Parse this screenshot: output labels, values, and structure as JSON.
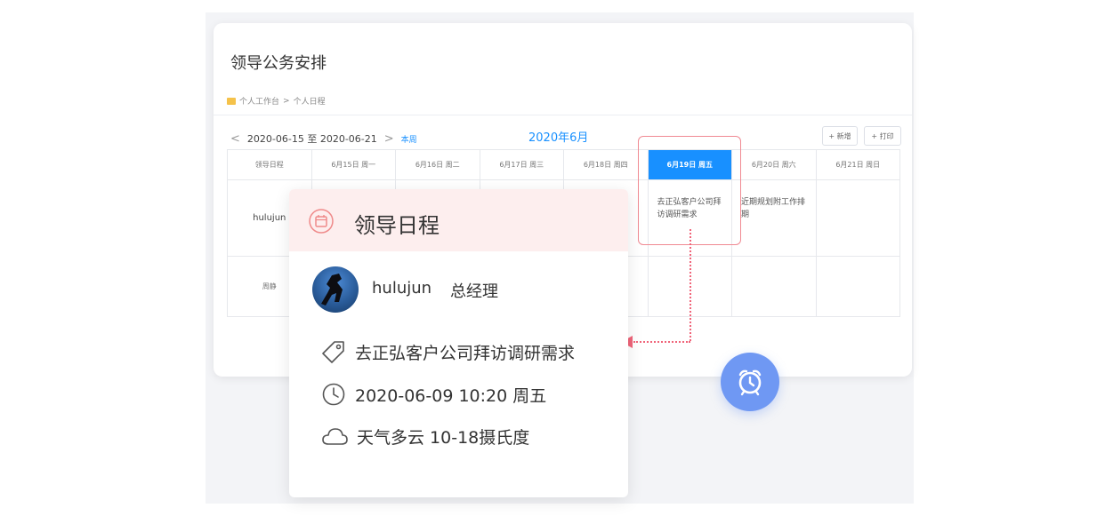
{
  "page": {
    "title": "领导公务安排",
    "breadcrumb": [
      "个人工作台",
      ">",
      "个人日程"
    ]
  },
  "toolbar": {
    "prev_arrow": "<",
    "next_arrow": ">",
    "date_range": "2020-06-15 至 2020-06-21",
    "this_week": "本周",
    "month": "2020年6月",
    "add_label": "+ 新增",
    "print_label": "+ 打印"
  },
  "calendar": {
    "headers": [
      "领导日程",
      "6月15日 周一",
      "6月16日 周二",
      "6月17日 周三",
      "6月18日 周四",
      "6月19日 周五",
      "6月20日 周六",
      "6月21日 周日"
    ],
    "rows": [
      {
        "name": "hulujun",
        "fri": "去正弘客户公司拜访调研需求",
        "sat": "近期规划附工作排期"
      },
      {
        "name": "周静"
      }
    ]
  },
  "popup": {
    "title": "领导日程",
    "user_name": "hulujun",
    "user_role": "总经理",
    "task": "去正弘客户公司拜访调研需求",
    "datetime": "2020-06-09   10:20 周五",
    "weather": "天气多云   10-18摄氏度"
  },
  "colors": {
    "accent": "#1890ff",
    "highlight": "#f0657a",
    "alarm": "#6f98f3",
    "popup_header": "#fdeeee"
  },
  "icons": [
    "calendar-icon",
    "avatar",
    "tag-icon",
    "clock-icon",
    "cloud-icon",
    "alarm-clock-icon"
  ]
}
